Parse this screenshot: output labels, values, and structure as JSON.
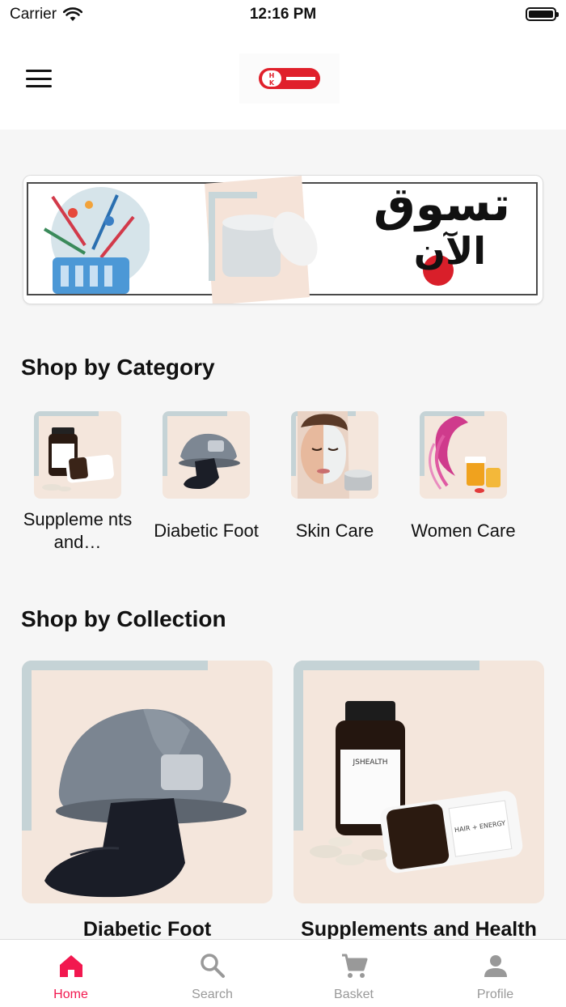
{
  "status_bar": {
    "carrier": "Carrier",
    "time": "12:16 PM"
  },
  "header": {
    "logo_text": "HK"
  },
  "banner": {
    "line1": "تسوق",
    "line2": "الآن"
  },
  "categories_section": {
    "title": "Shop by Category",
    "items": [
      {
        "label": "Suppleme nts and…"
      },
      {
        "label": "Diabetic Foot"
      },
      {
        "label": "Skin Care"
      },
      {
        "label": "Women Care"
      }
    ]
  },
  "collections_section": {
    "title": "Shop by Collection",
    "items": [
      {
        "label": "Diabetic Foot"
      },
      {
        "label": "Supplements and Health Care"
      }
    ]
  },
  "tab_bar": {
    "active_color": "#f2184f",
    "inactive_color": "#999999",
    "tabs": [
      {
        "label": "Home",
        "icon": "home-icon"
      },
      {
        "label": "Search",
        "icon": "search-icon"
      },
      {
        "label": "Basket",
        "icon": "cart-icon"
      },
      {
        "label": "Profile",
        "icon": "person-icon"
      }
    ]
  },
  "product_text": {
    "bottle_brand": "JSHEALTH",
    "bottle_product": "HAIR + ENERGY"
  }
}
